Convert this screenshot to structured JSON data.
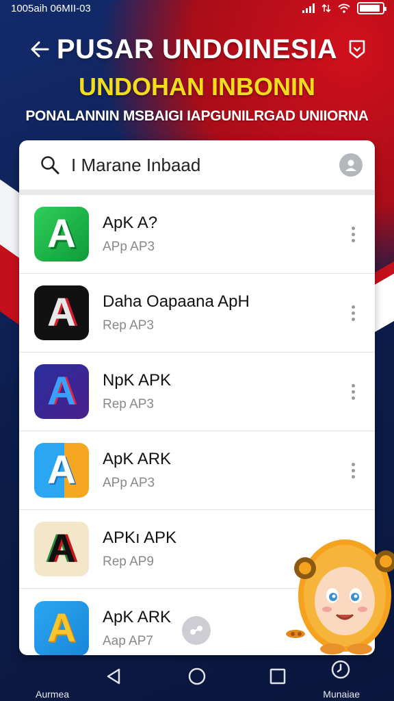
{
  "statusbar": {
    "time": "1005aih 06MII-03"
  },
  "header": {
    "title": "PUSAR UNDOINESIA",
    "subtitle": "UNDOHAN INBONIN",
    "tagline": "PONALANNIN MSBAIGI IAPGUNILRGAD UNIIORNA"
  },
  "search": {
    "value": "I Marane Inbaad"
  },
  "apps": [
    {
      "name": "ApK A?",
      "sub": "APp AP3"
    },
    {
      "name": "Daha Oapaana ApH",
      "sub": "Rep AP3"
    },
    {
      "name": "NpK APK",
      "sub": "Rep AP3"
    },
    {
      "name": "ApK ARK",
      "sub": "APp AP3"
    },
    {
      "name": "APKı APK",
      "sub": "Rep AP9"
    },
    {
      "name": "ApK ARK",
      "sub": "Aap AP7"
    }
  ],
  "navbar": {
    "left_label": "Aurmea",
    "right_label": "Munaiae"
  },
  "colors": {
    "accent_yellow": "#f2dc1c",
    "flag_red": "#c4101b",
    "navy": "#0f1f4d"
  },
  "icons": {
    "back": "back-arrow-icon",
    "shield": "shield-icon",
    "search": "search-icon",
    "profile": "profile-icon",
    "more": "kebab-menu-icon",
    "nav_back": "triangle-back-icon",
    "nav_home": "circle-home-icon",
    "nav_recents": "square-recents-icon",
    "nav_right": "clock-icon"
  },
  "battery_level": 0.9
}
